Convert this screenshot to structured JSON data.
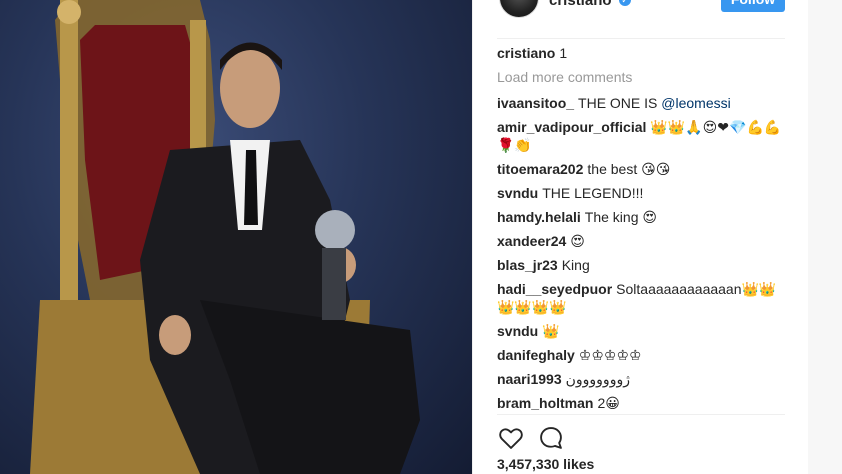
{
  "post": {
    "username": "cristiano",
    "follow_label": "Follow",
    "likes": "3,457,330 likes"
  },
  "comments": {
    "load_more": "Load more comments",
    "caption": {
      "user": "cristiano",
      "text": "1"
    },
    "items": [
      {
        "user": "ivaansitoo_",
        "text": "THE ONE IS ",
        "mention": "@leomessi"
      },
      {
        "user": "amir_vadipour_official",
        "text": "👑👑🙏😍❤💎💪💪🌹👏"
      },
      {
        "user": "titoemara202",
        "text": "the best 😘😘"
      },
      {
        "user": "svndu",
        "text": "THE LEGEND!!!"
      },
      {
        "user": "hamdy.helali",
        "text": "The king 😍"
      },
      {
        "user": "xandeer24",
        "text": "😍"
      },
      {
        "user": "blas_jr23",
        "text": "King"
      },
      {
        "user": "hadi__seyedpuor",
        "text": "Soltaaaaaaaaaaaan👑👑👑👑👑👑"
      },
      {
        "user": "svndu",
        "text": "👑"
      },
      {
        "user": "danifeghaly",
        "text": "♔♔♔♔♔"
      },
      {
        "user": "naari1993",
        "text": "ژووووووون"
      },
      {
        "user": "bram_holtman",
        "text": "2😀"
      }
    ]
  },
  "icons": {
    "like": "heart-icon",
    "comment": "comment-bubble-icon",
    "verified": "verified-badge-icon"
  },
  "colors": {
    "accent": "#3897f0",
    "text": "#262626",
    "muted": "#999999",
    "mention": "#003569"
  }
}
